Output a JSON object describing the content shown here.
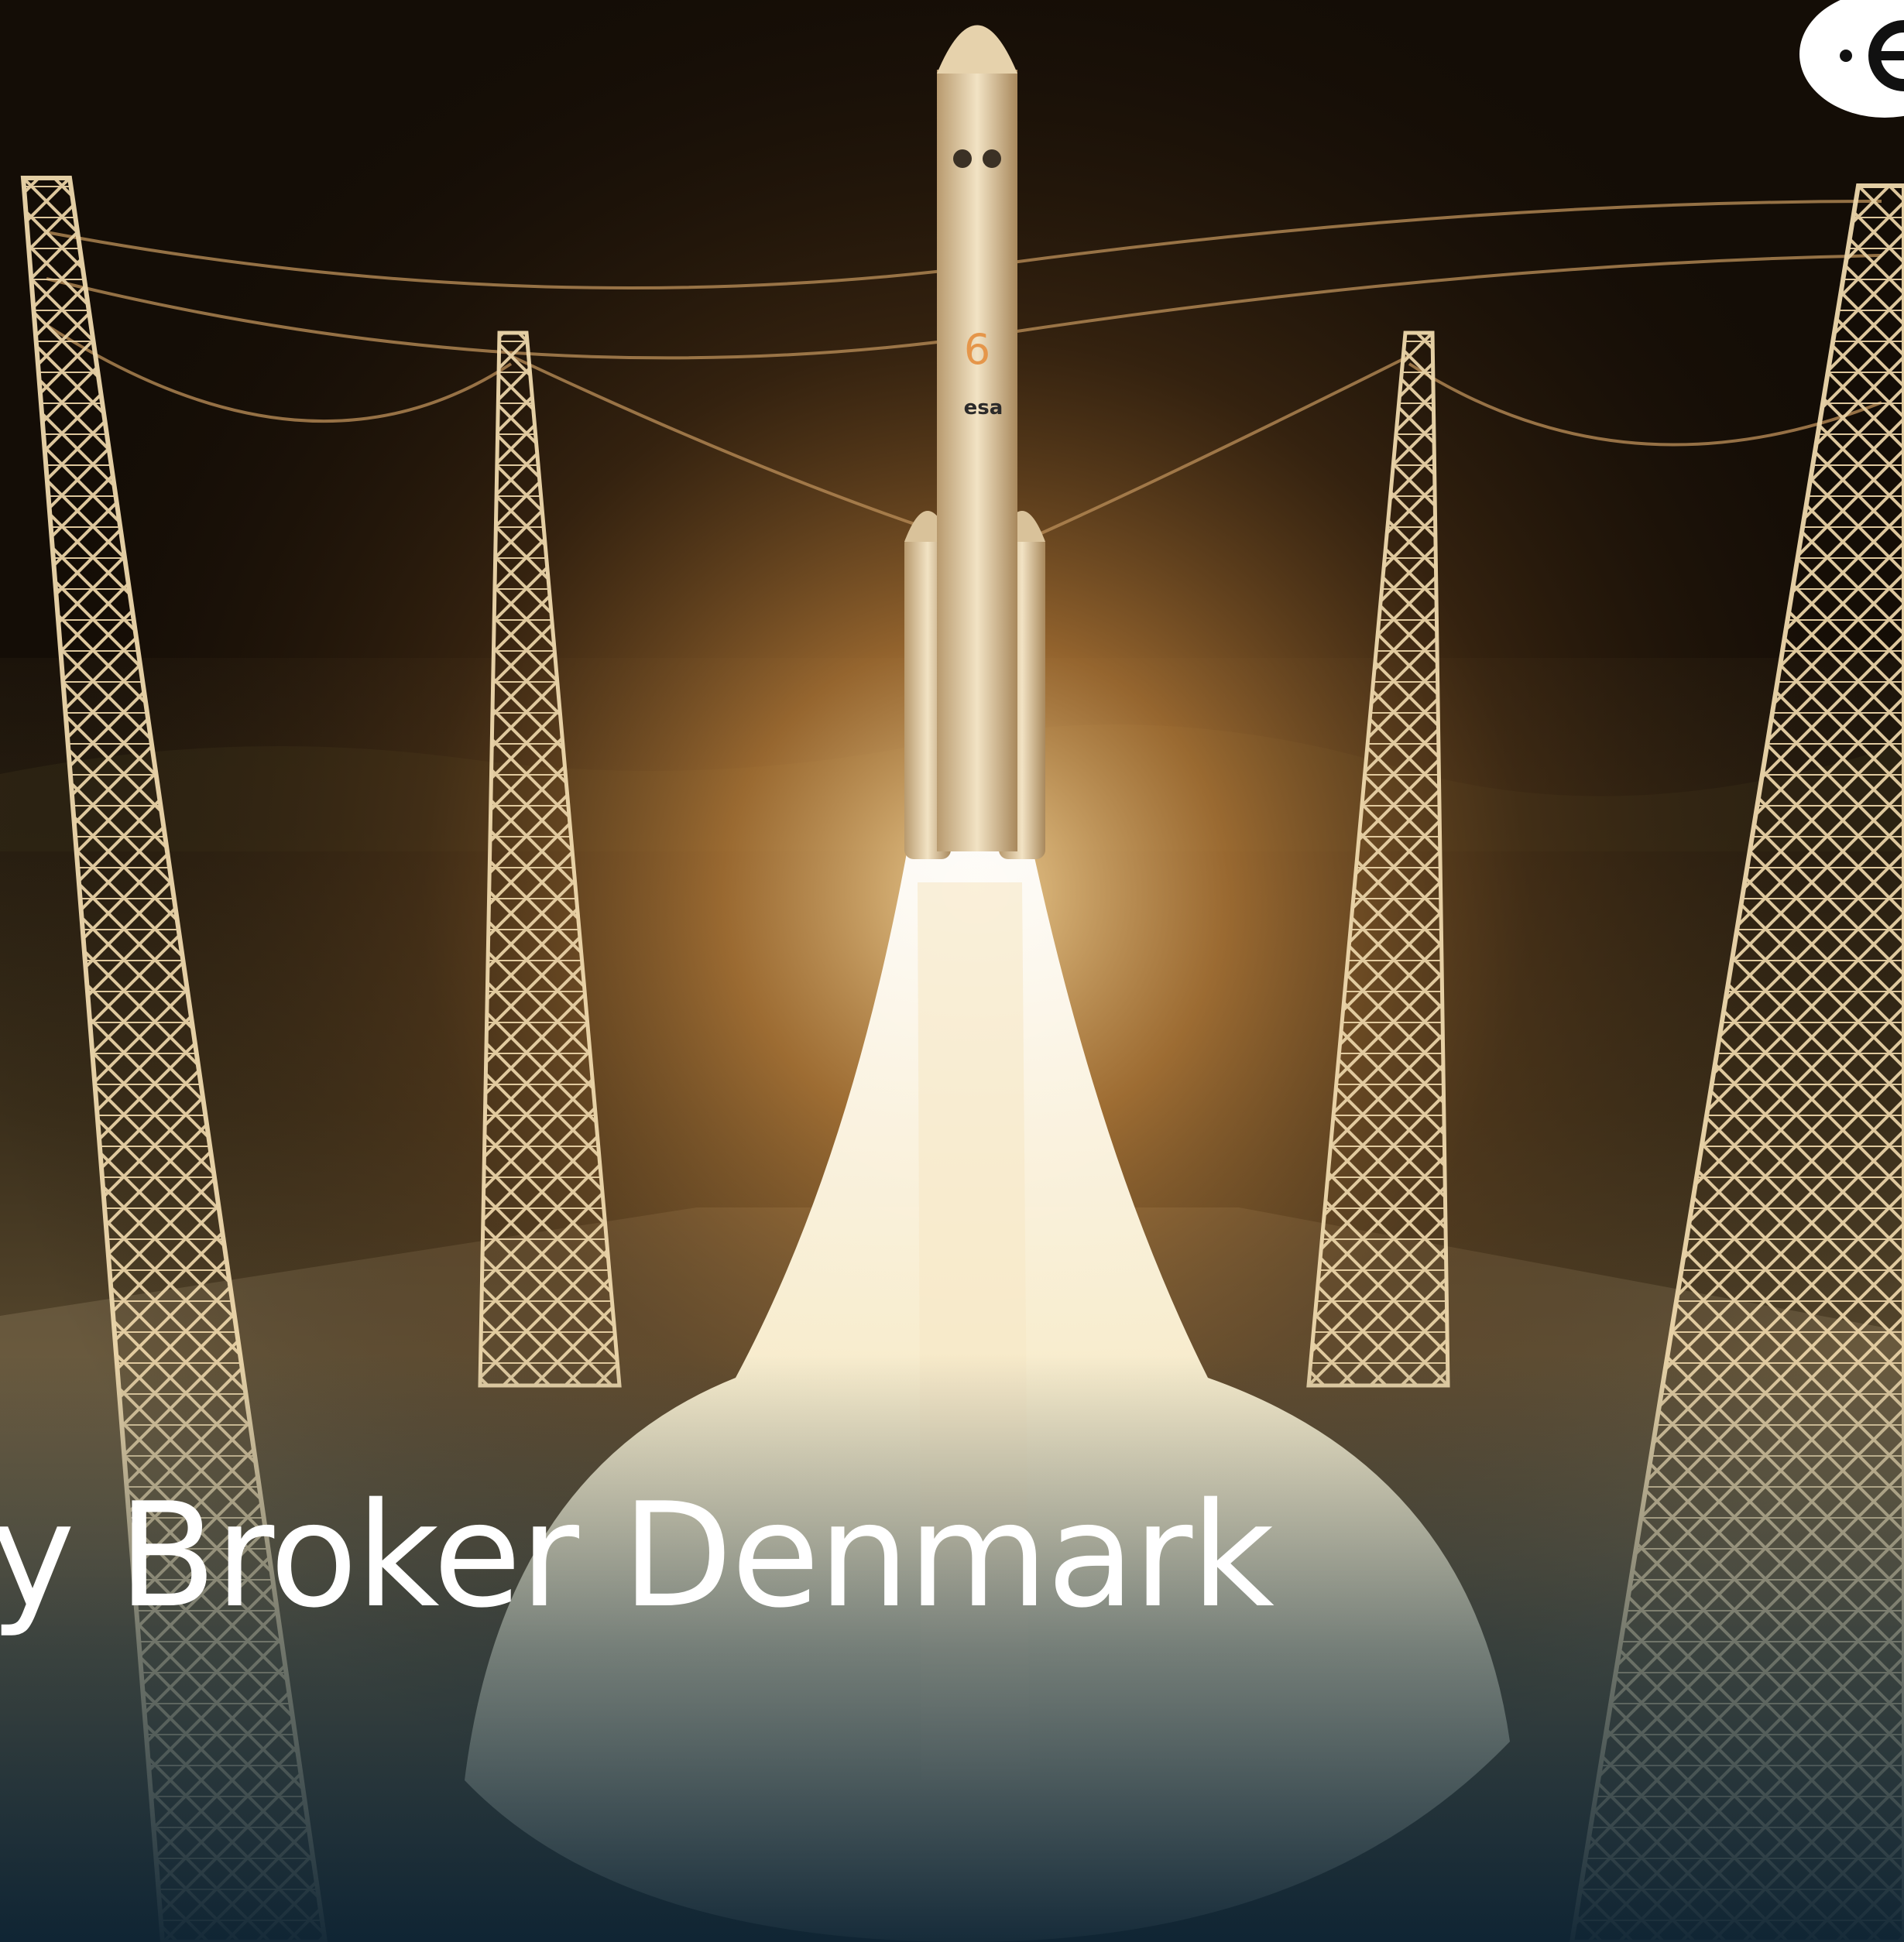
{
  "hero": {
    "headline": "ogy Broker Denmark",
    "image_subject": "Ariane 6 rocket lifting off from launch pad between four lightning towers at night",
    "rocket_markings": [
      "esa",
      "6"
    ]
  },
  "logo": {
    "icon": "esa-logo-icon",
    "color": "#ffffff"
  },
  "colors": {
    "sky": "#140d06",
    "flame": "#fff6d8",
    "glow": "#d89a4a",
    "ground": "#5a4a30",
    "smoke": "#e8e2d4",
    "bottom_tint": "#0f2a3a",
    "text": "#ffffff"
  }
}
